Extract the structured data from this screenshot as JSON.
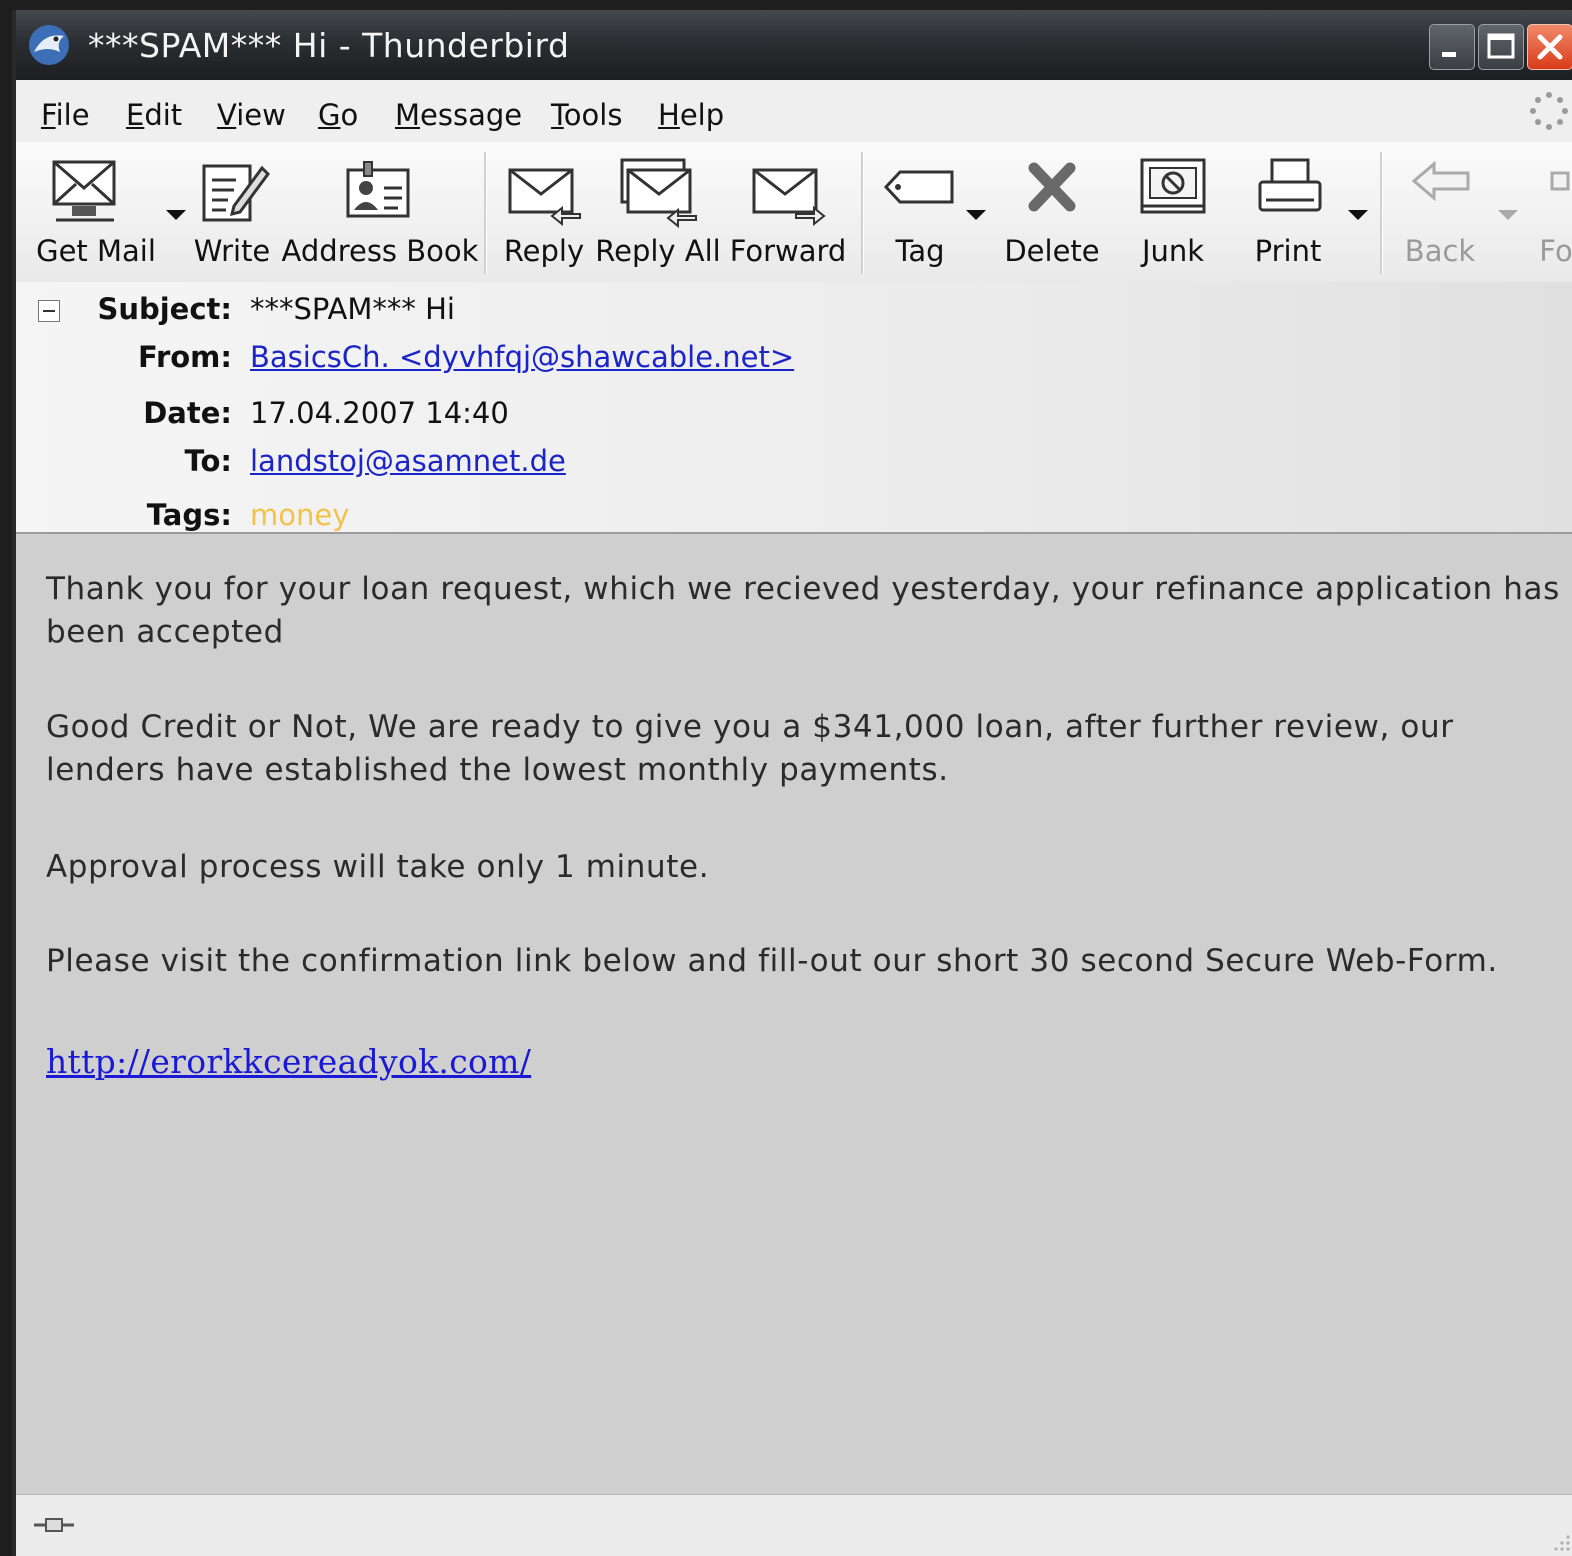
{
  "window": {
    "title": "***SPAM*** Hi - Thunderbird"
  },
  "menu": [
    "File",
    "Edit",
    "View",
    "Go",
    "Message",
    "Tools",
    "Help"
  ],
  "toolbar": {
    "get_mail": "Get Mail",
    "write": "Write",
    "address_book": "Address Book",
    "reply": "Reply",
    "reply_all": "Reply All",
    "forward": "Forward",
    "tag": "Tag",
    "delete": "Delete",
    "junk": "Junk",
    "print": "Print",
    "back": "Back",
    "forward_nav": "Fo"
  },
  "header": {
    "subject_label": "Subject:",
    "subject": "***SPAM*** Hi",
    "from_label": "From:",
    "from": "BasicsCh. <dyvhfqj@shawcable.net>",
    "date_label": "Date:",
    "date": "17.04.2007 14:40",
    "to_label": "To:",
    "to": "landstoj@asamnet.de",
    "tags_label": "Tags:",
    "tags": "money"
  },
  "body": {
    "p1": "Thank you for your loan request, which we recieved yesterday, your refinance application has been accepted",
    "p2": "Good Credit or Not, We are ready to give you a $341,000 loan, after further review, our lenders have established the lowest monthly payments.",
    "p3": "Approval process will take only 1 minute.",
    "p4": "Please visit the confirmation link below and fill-out our short 30 second Secure Web-Form.",
    "link": "http://erorkkcereadyok.com/"
  },
  "colors": {
    "link": "#1a24c8",
    "tag_money": "#f2c24a",
    "body_bg": "#cfcfcf"
  }
}
